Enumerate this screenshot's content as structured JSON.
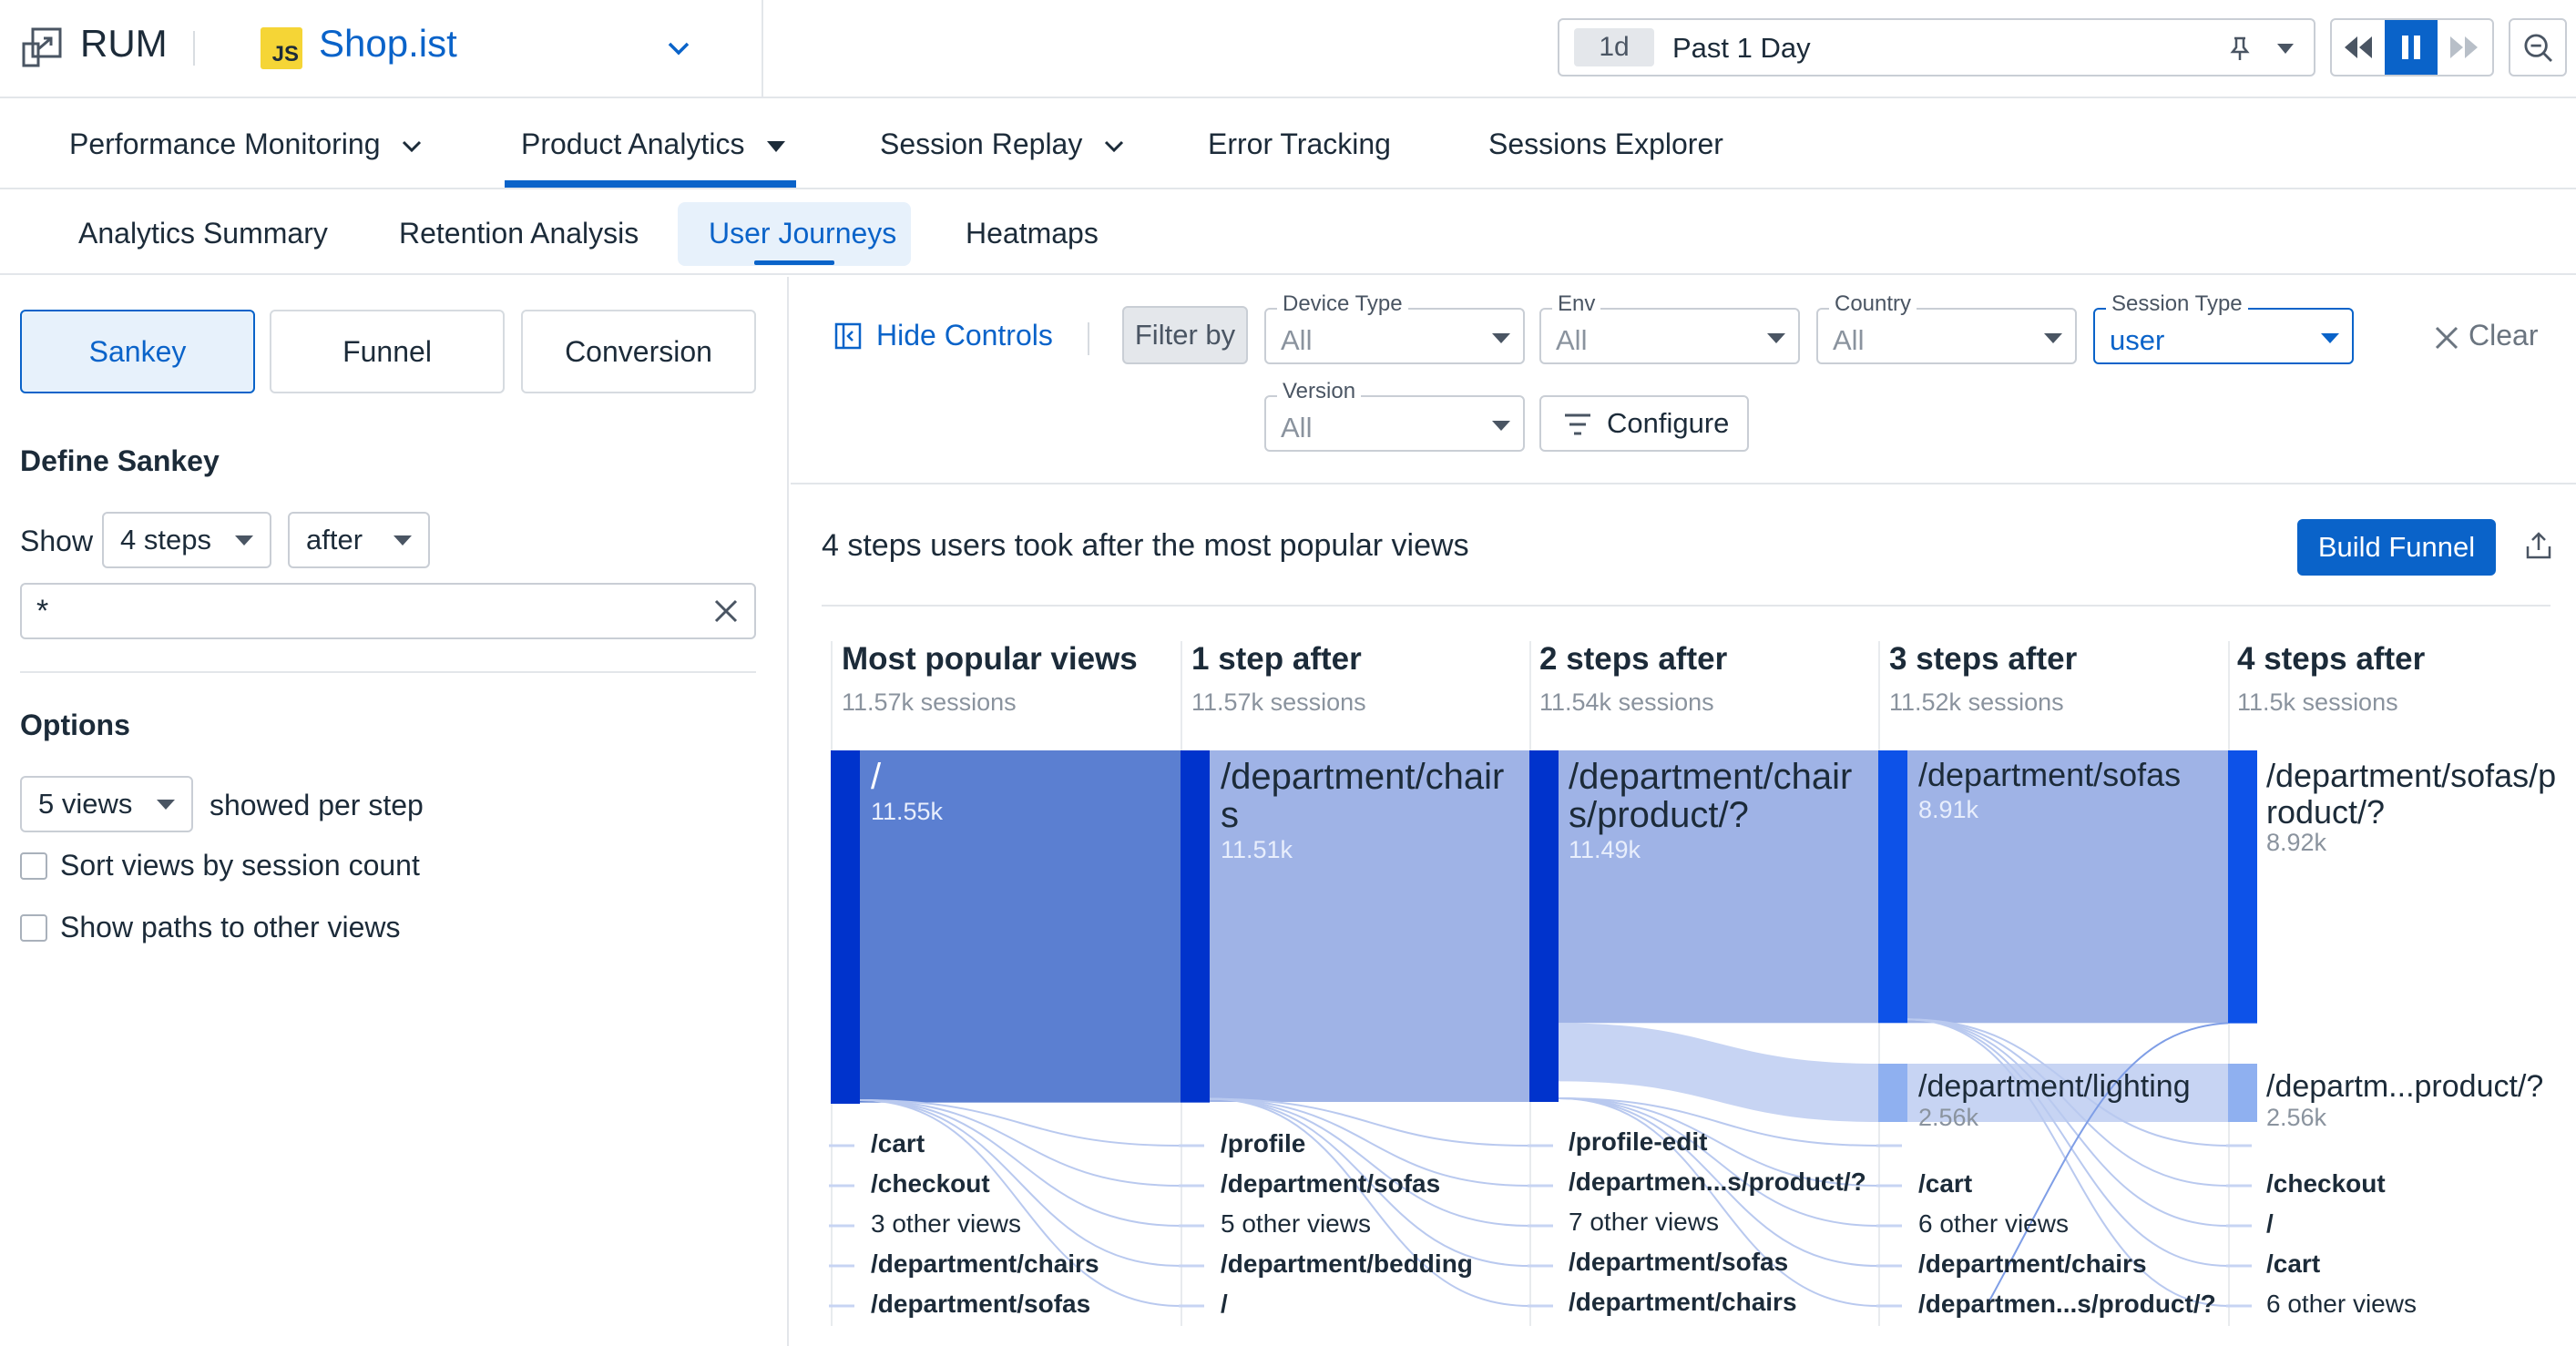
{
  "app": {
    "product": "RUM",
    "js_badge": "JS",
    "selected_app": "Shop.ist"
  },
  "time": {
    "short": "1d",
    "label": "Past 1 Day"
  },
  "nav": {
    "performance": "Performance Monitoring",
    "product_analytics": "Product Analytics",
    "session_replay": "Session Replay",
    "error_tracking": "Error Tracking",
    "sessions_explorer": "Sessions Explorer"
  },
  "subnav": {
    "summary": "Analytics Summary",
    "retention": "Retention Analysis",
    "journeys": "User Journeys",
    "heatmaps": "Heatmaps"
  },
  "left": {
    "modes": [
      "Sankey",
      "Funnel",
      "Conversion"
    ],
    "define_title": "Define Sankey",
    "show_label": "Show",
    "steps_value": "4 steps",
    "direction_value": "after",
    "view_input": "*",
    "options_title": "Options",
    "views_value": "5 views",
    "views_suffix": "showed per step",
    "sort_label": "Sort views by session count",
    "paths_label": "Show paths to other views"
  },
  "controls": {
    "hide_controls": "Hide Controls",
    "filter_by": "Filter by",
    "device_type_label": "Device Type",
    "device_type_value": "All",
    "env_label": "Env",
    "env_value": "All",
    "country_label": "Country",
    "country_value": "All",
    "session_type_label": "Session Type",
    "session_type_value": "user",
    "clear": "Clear",
    "version_label": "Version",
    "version_value": "All",
    "configure": "Configure"
  },
  "chart_header": {
    "title": "4 steps users took after the most popular views",
    "build_funnel": "Build Funnel"
  },
  "chart_data": {
    "type": "sankey",
    "title": "4 steps users took after the most popular views",
    "columns": [
      {
        "title": "Most popular views",
        "sessions": "11.57k sessions",
        "main": {
          "label": "/",
          "count": "11.55k",
          "value": 11550
        },
        "others": [
          "/cart",
          "/checkout",
          "3 other views",
          "/department/chairs",
          "/department/sofas"
        ]
      },
      {
        "title": "1 step after",
        "sessions": "11.57k sessions",
        "main": {
          "label": "/department/chairs",
          "count": "11.51k",
          "value": 11510
        },
        "others": [
          "/profile",
          "/department/sofas",
          "5 other views",
          "/department/bedding",
          "/"
        ]
      },
      {
        "title": "2 steps after",
        "sessions": "11.54k sessions",
        "main": {
          "label": "/department/chairs/product/?",
          "count": "11.49k",
          "value": 11490
        },
        "others": [
          "/profile-edit",
          "/departmen...s/product/?",
          "7 other views",
          "/department/sofas",
          "/department/chairs"
        ]
      },
      {
        "title": "3 steps after",
        "sessions": "11.52k sessions",
        "main": {
          "label": "/department/sofas",
          "count": "8.91k",
          "value": 8910
        },
        "second": {
          "label": "/department/lighting",
          "count": "2.56k",
          "value": 2560
        },
        "others": [
          "/cart",
          "6 other views",
          "/department/chairs",
          "/departmen...s/product/?"
        ]
      },
      {
        "title": "4 steps after",
        "sessions": "11.5k sessions",
        "main": {
          "label": "/department/sofas/product/?",
          "count": "8.92k",
          "value": 8920
        },
        "second": {
          "label": "/departm...product/?",
          "count": "2.56k",
          "value": 2560
        },
        "others": [
          "/checkout",
          "/",
          "/cart",
          "6 other views"
        ]
      }
    ],
    "colors": {
      "node_dark": "#0033cc",
      "flow_main": "#5b7fd1",
      "flow_light": "#9fb3e6",
      "flow_pale": "#c7d4f3"
    }
  }
}
